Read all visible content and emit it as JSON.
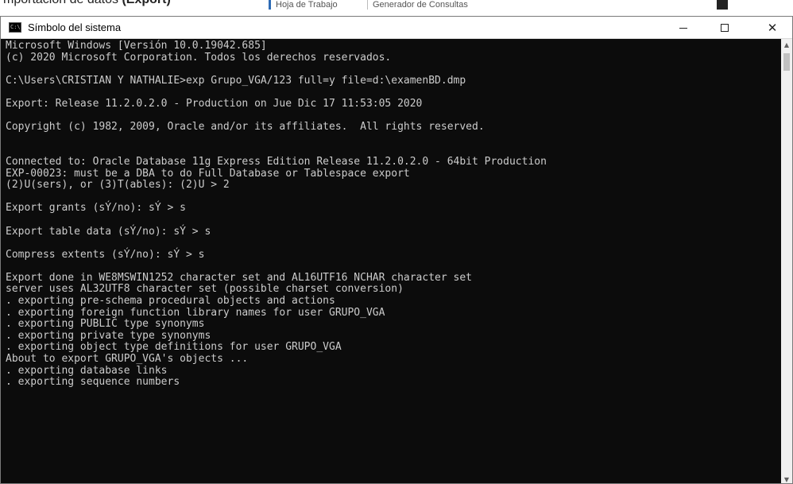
{
  "background": {
    "doc_text_prefix": "mportación de datos",
    "doc_text_bold": "(Export)",
    "tabs": [
      "Hoja de Trabajo",
      "Generador de Consultas"
    ]
  },
  "window": {
    "title": "Símbolo del sistema",
    "icon_label": "C:\\",
    "buttons": {
      "minimize": "—",
      "maximize": "☐",
      "close": "✕"
    }
  },
  "console": {
    "text_color": "#cccccc",
    "background_color": "#0c0c0c",
    "lines": [
      "Microsoft Windows [Versión 10.0.19042.685]",
      "(c) 2020 Microsoft Corporation. Todos los derechos reservados.",
      "",
      "C:\\Users\\CRISTIAN Y NATHALIE>exp Grupo_VGA/123 full=y file=d:\\examenBD.dmp",
      "",
      "Export: Release 11.2.0.2.0 - Production on Jue Dic 17 11:53:05 2020",
      "",
      "Copyright (c) 1982, 2009, Oracle and/or its affiliates.  All rights reserved.",
      "",
      "",
      "Connected to: Oracle Database 11g Express Edition Release 11.2.0.2.0 - 64bit Production",
      "EXP-00023: must be a DBA to do Full Database or Tablespace export",
      "(2)U(sers), or (3)T(ables): (2)U > 2",
      "",
      "Export grants (sÝ/no): sÝ > s",
      "",
      "Export table data (sÝ/no): sÝ > s",
      "",
      "Compress extents (sÝ/no): sÝ > s",
      "",
      "Export done in WE8MSWIN1252 character set and AL16UTF16 NCHAR character set",
      "server uses AL32UTF8 character set (possible charset conversion)",
      ". exporting pre-schema procedural objects and actions",
      ". exporting foreign function library names for user GRUPO_VGA",
      ". exporting PUBLIC type synonyms",
      ". exporting private type synonyms",
      ". exporting object type definitions for user GRUPO_VGA",
      "About to export GRUPO_VGA's objects ...",
      ". exporting database links",
      ". exporting sequence numbers"
    ]
  },
  "scrollbar": {
    "up_arrow": "▲",
    "down_arrow": "▼"
  }
}
